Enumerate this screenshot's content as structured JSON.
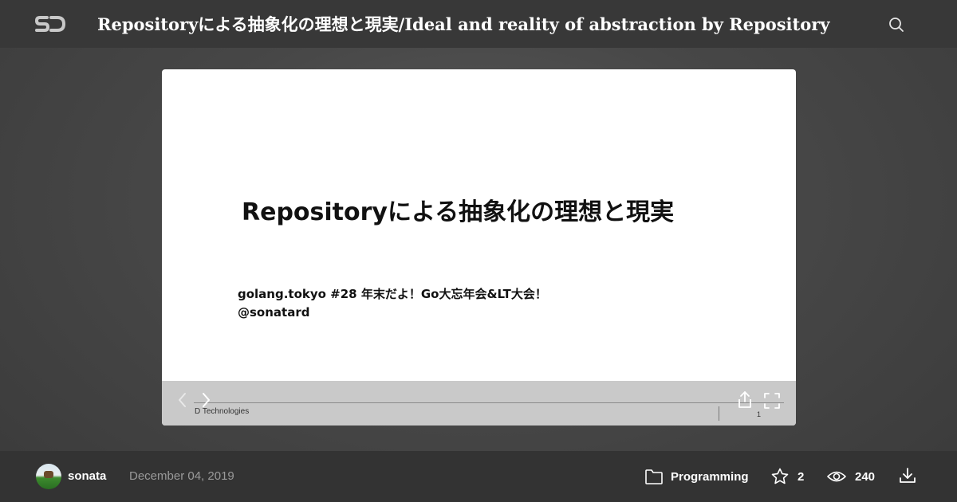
{
  "header": {
    "logo_text": "SD",
    "title": "Repositoryによる抽象化の理想と現実/Ideal and reality of abstraction by Repository",
    "search_icon": "search-icon"
  },
  "slide": {
    "heading": "Repositoryによる抽象化の理想と現実",
    "event": "golang.tokyo #28 年末だよ！Go大忘年会&LT大会！",
    "handle": "@sonatard",
    "footer_brand": "D Technologies",
    "page_number": "1"
  },
  "controls": {
    "prev_icon": "chevron-left-icon",
    "next_icon": "chevron-right-icon",
    "share_icon": "share-icon",
    "fullscreen_icon": "fullscreen-icon"
  },
  "footer": {
    "author": "sonata",
    "date": "December 04, 2019",
    "category": "Programming",
    "stars": "2",
    "views": "240",
    "download_icon": "download-icon"
  },
  "colors": {
    "background": "#474747",
    "topbar": "#383838",
    "bottombar": "#333333",
    "control_strip": "#c9c9c9"
  }
}
